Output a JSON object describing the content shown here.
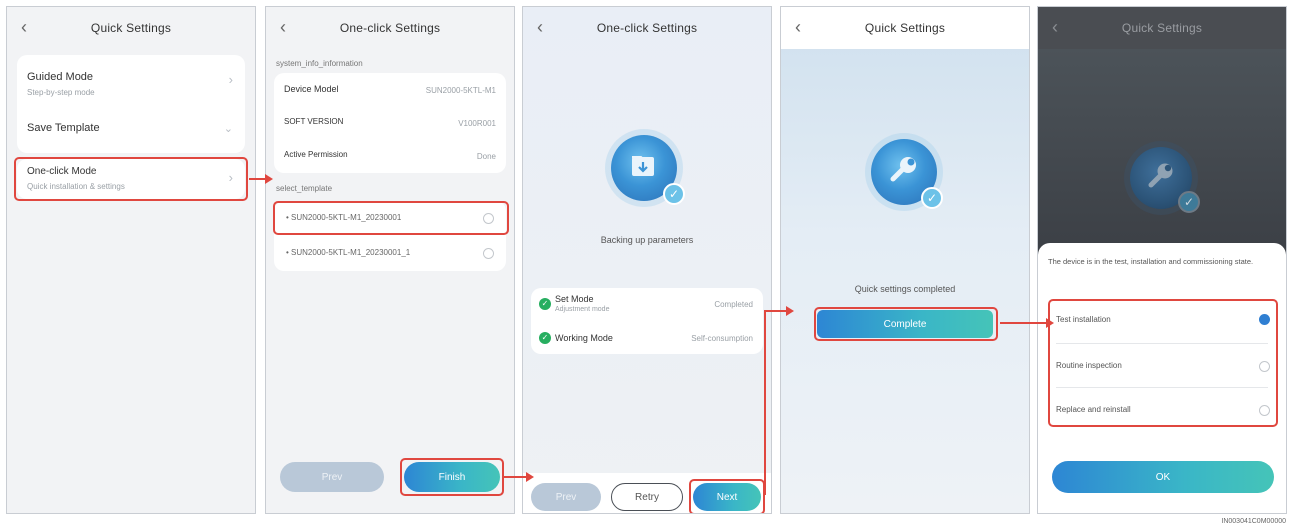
{
  "colors": {
    "accent": "#2d86d4",
    "highlight_red": "#e0473f",
    "success_green": "#27ae60"
  },
  "panel1": {
    "title": "Quick Settings",
    "back_icon": "chevron-left-icon",
    "items": [
      {
        "label": "Guided Mode",
        "sub": "Step-by-step mode"
      },
      {
        "label": "Save Template",
        "sub": ""
      },
      {
        "label": "One-click Mode",
        "sub": "Quick installation & settings"
      }
    ]
  },
  "panel2": {
    "title": "One-click Settings",
    "section1": "system_info_information",
    "info_rows": [
      {
        "label": "Device Model",
        "value": "SUN2000-5KTL-M1"
      },
      {
        "label": "SOFT VERSION",
        "value": "V100R001"
      },
      {
        "label": "Active Permission",
        "value": "Done"
      }
    ],
    "section2": "select_template",
    "templates": [
      "SUN2000-5KTL-M1_20230001",
      "SUN2000-5KTL-M1_20230001_1"
    ],
    "prev_label": "Prev",
    "next_label": "Finish"
  },
  "panel3": {
    "title": "One-click Settings",
    "status": "Backing up parameters",
    "results": [
      {
        "label": "Set Mode",
        "sub": "Adjustment mode",
        "value": "Completed"
      },
      {
        "label": "Working Mode",
        "value": "Self-consumption"
      }
    ],
    "buttons": [
      "Prev",
      "Retry",
      "Next"
    ]
  },
  "panel4": {
    "title": "Quick Settings",
    "status": "Quick settings completed",
    "complete_label": "Complete"
  },
  "panel5": {
    "title": "Quick Settings",
    "sheet_text": "The device is in the test, installation and commissioning state.",
    "options": [
      "Test installation",
      "Routine inspection",
      "Replace and reinstall"
    ],
    "selected_index": 0,
    "ok_label": "OK"
  },
  "watermark": "IN003041C0M00000"
}
